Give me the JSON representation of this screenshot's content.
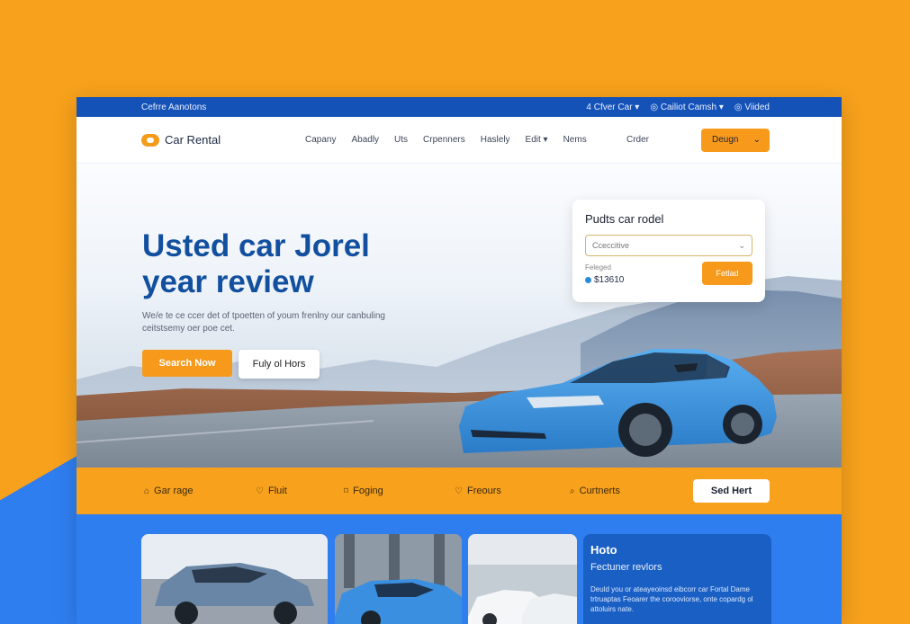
{
  "topbar": {
    "left": "Cefrre Aanotons",
    "items": [
      "4 Cfver Car ▾",
      "◎ Cailiot Camsh ▾",
      "◎ Viided"
    ]
  },
  "nav": {
    "brand": "Car Rental",
    "links": [
      "Capany",
      "Abadly",
      "Uts",
      "Crpenners",
      "Haslely",
      "Edit ▾",
      "Nems"
    ],
    "extra": "Crder",
    "design_button": "Deugn"
  },
  "hero": {
    "title_line1": "Usted car Jorel",
    "title_line2": "year review",
    "subtitle": "We/e te ce ccer det of tpoetten of youm frenlny our canbuling ceitstsemy oer poe cet.",
    "primary_button": "Search Now",
    "secondary_button": "Fuly ol Hors"
  },
  "widget": {
    "title": "Pudts car rodel",
    "select_value": "Cceccitive",
    "label": "Feleged",
    "price": "$13610",
    "button": "Fetlad"
  },
  "strip": {
    "items": [
      {
        "icon": "garage-icon",
        "label": "Gar rage"
      },
      {
        "icon": "fuel-icon",
        "label": "Fluit"
      },
      {
        "icon": "tag-icon",
        "label": "Foging"
      },
      {
        "icon": "heart-icon",
        "label": "Freours"
      },
      {
        "icon": "search-icon",
        "label": "Curtnerts"
      }
    ],
    "button": "Sed Hert"
  },
  "info_card": {
    "title": "Hoto",
    "subtitle": "Fectuner revlors",
    "body": "Deuld you or ateayeoinsd eibcorr car Fortal Dame trtruaptas Feoarer the corooviorse, onte copardg ol attoluirs nate."
  },
  "colors": {
    "accent": "#f79a1c",
    "brand_blue": "#1552b8",
    "title_blue": "#12509f",
    "section_blue": "#2f7ef0"
  }
}
